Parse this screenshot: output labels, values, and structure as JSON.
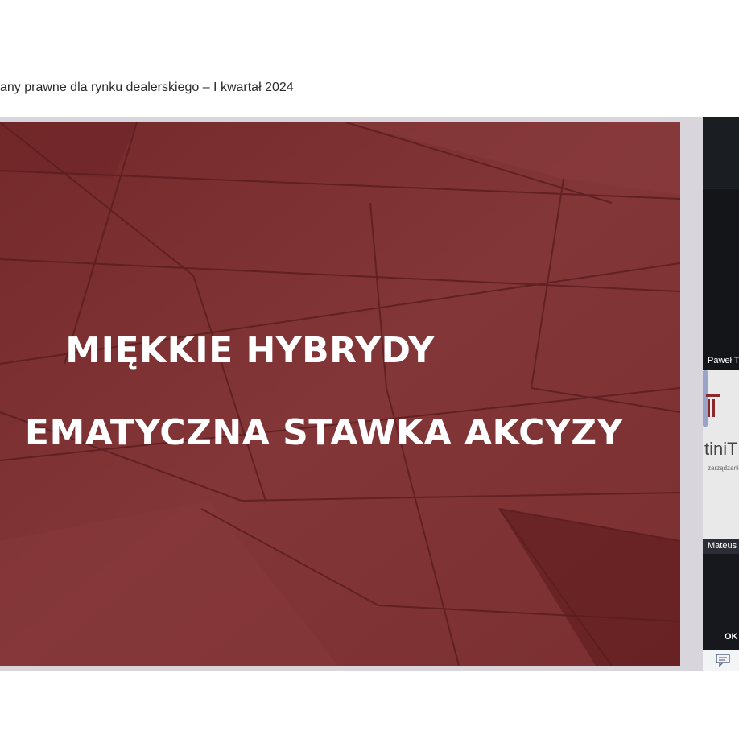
{
  "meeting": {
    "title": "any prawne dla rynku dealerskiego – I kwartał 2024"
  },
  "slide": {
    "line1": "MIĘKKIE HYBRYDY",
    "line2": "EMATYCZNA STAWKA AKCYZY",
    "background_color": "#7e3133"
  },
  "participants": {
    "tile1_name": "Paweł T",
    "tile2_name": "Mateus",
    "tile2_logo_text": "tiniT",
    "tile2_logo_sub": "zarządzanie",
    "panel_button": "OK"
  },
  "icons": {
    "chat": "chat-icon"
  }
}
